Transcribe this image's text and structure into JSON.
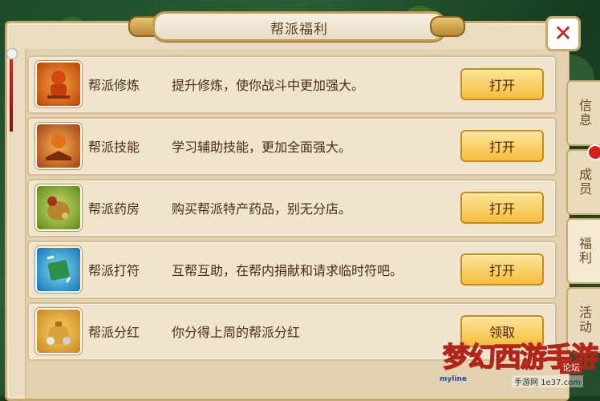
{
  "window": {
    "title": "帮派福利"
  },
  "tabs": [
    {
      "label": "信息"
    },
    {
      "label": "成员"
    },
    {
      "label": "福利"
    },
    {
      "label": "活动"
    }
  ],
  "rows": [
    {
      "icon": "cultivation-icon",
      "name": "帮派修炼",
      "desc": "提升修炼，使你战斗中更加强大。",
      "button": "打开"
    },
    {
      "icon": "skill-icon",
      "name": "帮派技能",
      "desc": "学习辅助技能，更加全面强大。",
      "button": "打开"
    },
    {
      "icon": "pharmacy-icon",
      "name": "帮派药房",
      "desc": "购买帮派特产药品，别无分店。",
      "button": "打开"
    },
    {
      "icon": "talisman-icon",
      "name": "帮派打符",
      "desc": "互帮互助，在帮内捐献和请求临时符吧。",
      "button": "打开"
    },
    {
      "icon": "dividend-icon",
      "name": "帮派分红",
      "desc": "你分得上周的帮派分红",
      "button": "领取"
    }
  ],
  "watermark": {
    "logo": "梦幻西游手游",
    "site_cn": "论坛",
    "url": "手游网 1e37.com",
    "tag": "myline"
  }
}
